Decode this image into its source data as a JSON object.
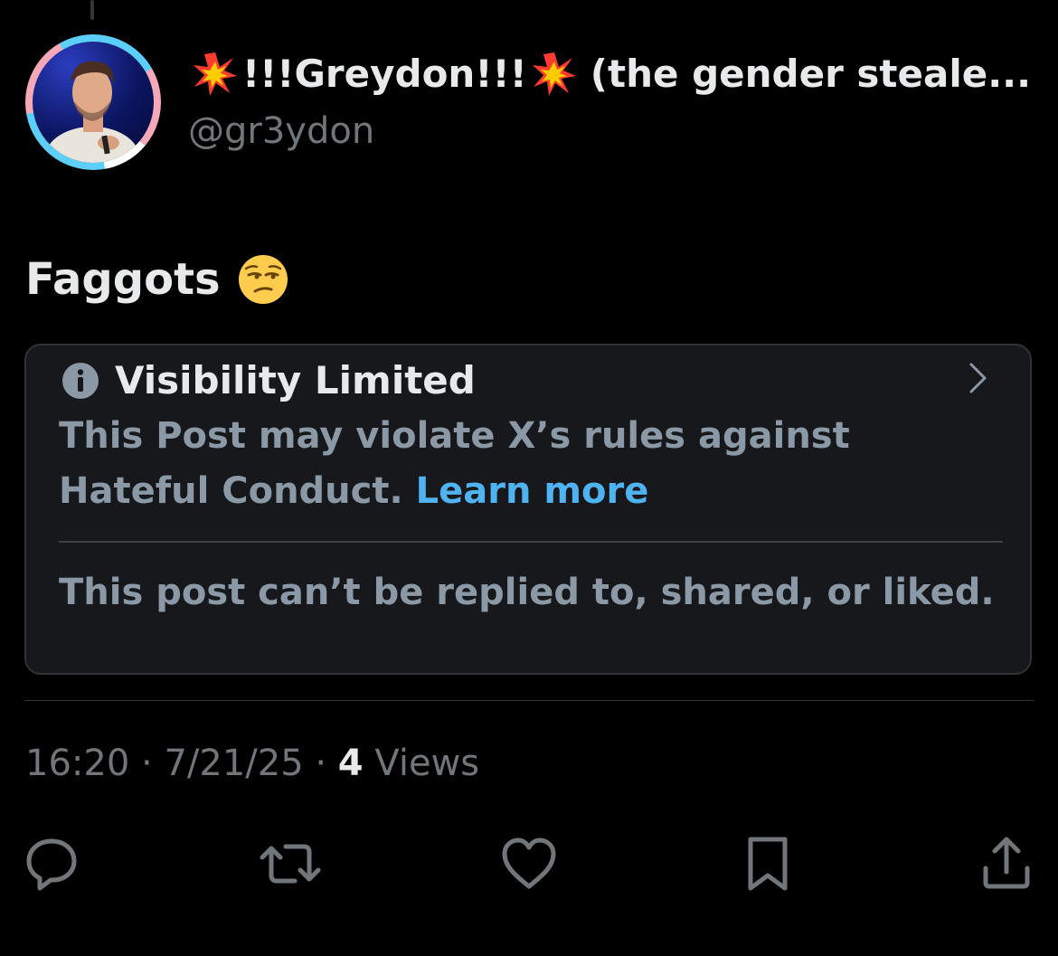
{
  "author": {
    "display_name": "!!!Greydon!!!",
    "display_name_suffix": "(the gender steale...",
    "handle": "@gr3ydon",
    "name_emoji": "collision-emoji"
  },
  "post": {
    "text": "Faggots",
    "emoji": "unamused-face-emoji"
  },
  "notice": {
    "title": "Visibility Limited",
    "body": "This Post may violate X’s rules against Hateful Conduct.",
    "link": "Learn more",
    "footer": "This post can’t be replied to, shared, or liked.",
    "icon": "info-icon"
  },
  "meta": {
    "time": "16:20",
    "separator": "·",
    "date": "7/21/25",
    "views_count": "4",
    "views_label": "Views"
  },
  "actions": [
    "reply-icon",
    "repost-icon",
    "like-icon",
    "bookmark-icon",
    "share-icon"
  ],
  "colors": {
    "background": "#000000",
    "primary_text": "#e7e9ea",
    "secondary_text": "#71767b",
    "notice_background": "#16181c",
    "link": "#4fb2f1"
  }
}
